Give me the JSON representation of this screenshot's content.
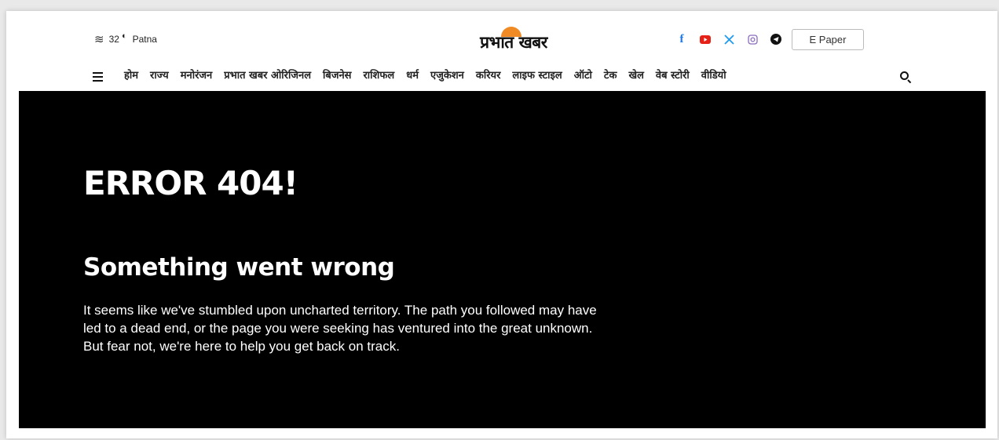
{
  "weather": {
    "icon": "haze-icon",
    "temperature": "32",
    "condition_icon": "moon-icon",
    "city": "Patna"
  },
  "brand": {
    "logo_text": "प्रभात खबर",
    "accent": "#f08a24"
  },
  "social": [
    {
      "name": "facebook-icon",
      "glyph": "f",
      "color": "#1877f2"
    },
    {
      "name": "youtube-icon",
      "glyph": "▶",
      "color": "#e62117"
    },
    {
      "name": "x-icon",
      "glyph": "𝕏",
      "color": "#1d9bf0"
    },
    {
      "name": "instagram-icon",
      "glyph": "◎",
      "color": "#c13584"
    },
    {
      "name": "telegram-icon",
      "glyph": "➤",
      "color": "#111111"
    }
  ],
  "header": {
    "epaper_label": "E Paper"
  },
  "nav": {
    "items": [
      {
        "label": "होम"
      },
      {
        "label": "राज्य"
      },
      {
        "label": "मनोरंजन"
      },
      {
        "label": "प्रभात खबर ओरिजिनल"
      },
      {
        "label": "बिजनेस"
      },
      {
        "label": "राशिफल"
      },
      {
        "label": "धर्म"
      },
      {
        "label": "एजुकेशन"
      },
      {
        "label": "करियर"
      },
      {
        "label": "लाइफ स्टाइल"
      },
      {
        "label": "ऑटो"
      },
      {
        "label": "टेक"
      },
      {
        "label": "खेल"
      },
      {
        "label": "वेब स्टोरी"
      },
      {
        "label": "वीडियो"
      }
    ]
  },
  "error": {
    "code_title": "ERROR 404!",
    "heading": "Something went wrong",
    "message": "It seems like we've stumbled upon uncharted territory. The path you followed may have led to a dead end, or the page you were seeking has ventured into the great unknown. But fear not, we're here to help you get back on track."
  }
}
